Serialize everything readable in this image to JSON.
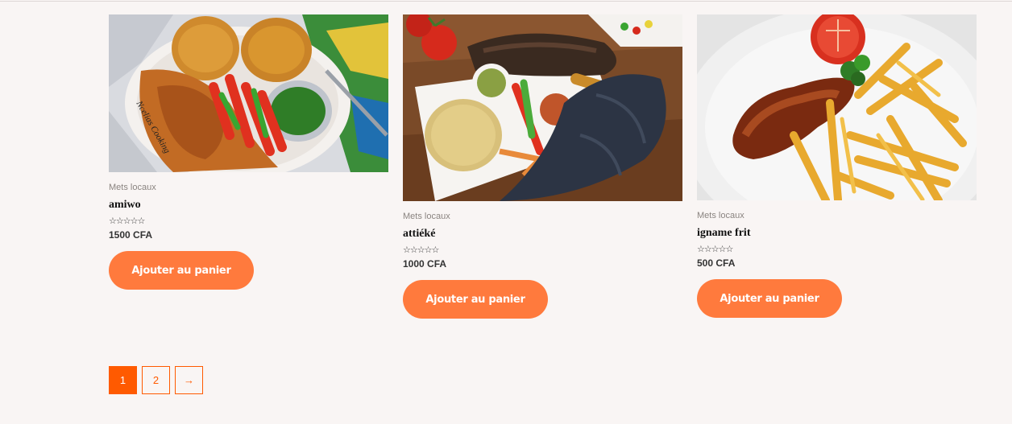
{
  "products": [
    {
      "image_label": "amiwo-photo",
      "category": "Mets locaux",
      "name": "amiwo",
      "rating": 0,
      "price": "1500 CFA",
      "button": "Ajouter au panier",
      "watermark": "Ncelias Cooking"
    },
    {
      "image_label": "attieke-photo",
      "category": "Mets locaux",
      "name": "attiéké",
      "rating": 0,
      "price": "1000 CFA",
      "button": "Ajouter au panier"
    },
    {
      "image_label": "igname-frit-photo",
      "category": "Mets locaux",
      "name": "igname frit",
      "rating": 0,
      "price": "500 CFA",
      "button": "Ajouter au panier"
    }
  ],
  "stars": "☆☆☆☆☆",
  "pagination": {
    "pages": [
      "1",
      "2"
    ],
    "current": "1",
    "next": "→"
  },
  "colors": {
    "accent": "#ff7a3d",
    "pager": "#ff5a00",
    "background": "#f9f5f4"
  }
}
